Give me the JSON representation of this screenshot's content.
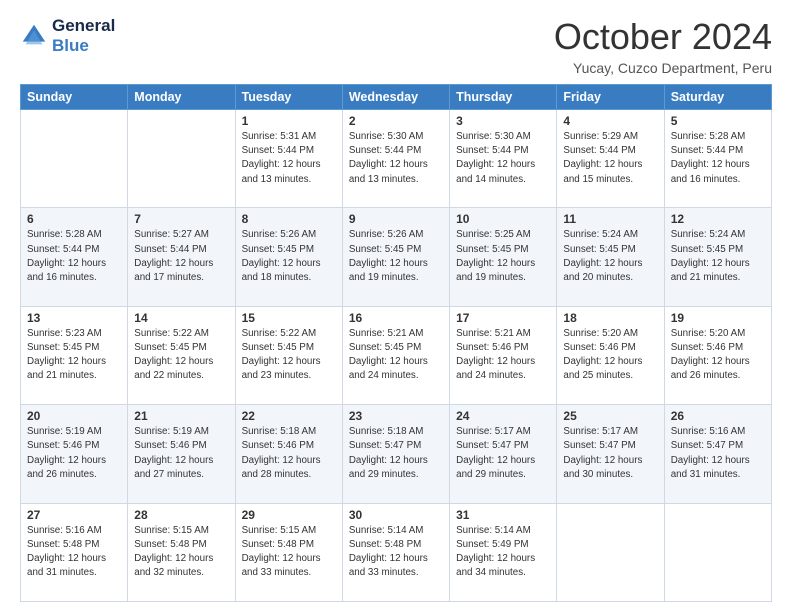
{
  "logo": {
    "line1": "General",
    "line2": "Blue"
  },
  "title": "October 2024",
  "subtitle": "Yucay, Cuzco Department, Peru",
  "days_header": [
    "Sunday",
    "Monday",
    "Tuesday",
    "Wednesday",
    "Thursday",
    "Friday",
    "Saturday"
  ],
  "weeks": [
    [
      {
        "day": "",
        "sunrise": "",
        "sunset": "",
        "daylight": ""
      },
      {
        "day": "",
        "sunrise": "",
        "sunset": "",
        "daylight": ""
      },
      {
        "day": "1",
        "sunrise": "Sunrise: 5:31 AM",
        "sunset": "Sunset: 5:44 PM",
        "daylight": "Daylight: 12 hours and 13 minutes."
      },
      {
        "day": "2",
        "sunrise": "Sunrise: 5:30 AM",
        "sunset": "Sunset: 5:44 PM",
        "daylight": "Daylight: 12 hours and 13 minutes."
      },
      {
        "day": "3",
        "sunrise": "Sunrise: 5:30 AM",
        "sunset": "Sunset: 5:44 PM",
        "daylight": "Daylight: 12 hours and 14 minutes."
      },
      {
        "day": "4",
        "sunrise": "Sunrise: 5:29 AM",
        "sunset": "Sunset: 5:44 PM",
        "daylight": "Daylight: 12 hours and 15 minutes."
      },
      {
        "day": "5",
        "sunrise": "Sunrise: 5:28 AM",
        "sunset": "Sunset: 5:44 PM",
        "daylight": "Daylight: 12 hours and 16 minutes."
      }
    ],
    [
      {
        "day": "6",
        "sunrise": "Sunrise: 5:28 AM",
        "sunset": "Sunset: 5:44 PM",
        "daylight": "Daylight: 12 hours and 16 minutes."
      },
      {
        "day": "7",
        "sunrise": "Sunrise: 5:27 AM",
        "sunset": "Sunset: 5:44 PM",
        "daylight": "Daylight: 12 hours and 17 minutes."
      },
      {
        "day": "8",
        "sunrise": "Sunrise: 5:26 AM",
        "sunset": "Sunset: 5:45 PM",
        "daylight": "Daylight: 12 hours and 18 minutes."
      },
      {
        "day": "9",
        "sunrise": "Sunrise: 5:26 AM",
        "sunset": "Sunset: 5:45 PM",
        "daylight": "Daylight: 12 hours and 19 minutes."
      },
      {
        "day": "10",
        "sunrise": "Sunrise: 5:25 AM",
        "sunset": "Sunset: 5:45 PM",
        "daylight": "Daylight: 12 hours and 19 minutes."
      },
      {
        "day": "11",
        "sunrise": "Sunrise: 5:24 AM",
        "sunset": "Sunset: 5:45 PM",
        "daylight": "Daylight: 12 hours and 20 minutes."
      },
      {
        "day": "12",
        "sunrise": "Sunrise: 5:24 AM",
        "sunset": "Sunset: 5:45 PM",
        "daylight": "Daylight: 12 hours and 21 minutes."
      }
    ],
    [
      {
        "day": "13",
        "sunrise": "Sunrise: 5:23 AM",
        "sunset": "Sunset: 5:45 PM",
        "daylight": "Daylight: 12 hours and 21 minutes."
      },
      {
        "day": "14",
        "sunrise": "Sunrise: 5:22 AM",
        "sunset": "Sunset: 5:45 PM",
        "daylight": "Daylight: 12 hours and 22 minutes."
      },
      {
        "day": "15",
        "sunrise": "Sunrise: 5:22 AM",
        "sunset": "Sunset: 5:45 PM",
        "daylight": "Daylight: 12 hours and 23 minutes."
      },
      {
        "day": "16",
        "sunrise": "Sunrise: 5:21 AM",
        "sunset": "Sunset: 5:45 PM",
        "daylight": "Daylight: 12 hours and 24 minutes."
      },
      {
        "day": "17",
        "sunrise": "Sunrise: 5:21 AM",
        "sunset": "Sunset: 5:46 PM",
        "daylight": "Daylight: 12 hours and 24 minutes."
      },
      {
        "day": "18",
        "sunrise": "Sunrise: 5:20 AM",
        "sunset": "Sunset: 5:46 PM",
        "daylight": "Daylight: 12 hours and 25 minutes."
      },
      {
        "day": "19",
        "sunrise": "Sunrise: 5:20 AM",
        "sunset": "Sunset: 5:46 PM",
        "daylight": "Daylight: 12 hours and 26 minutes."
      }
    ],
    [
      {
        "day": "20",
        "sunrise": "Sunrise: 5:19 AM",
        "sunset": "Sunset: 5:46 PM",
        "daylight": "Daylight: 12 hours and 26 minutes."
      },
      {
        "day": "21",
        "sunrise": "Sunrise: 5:19 AM",
        "sunset": "Sunset: 5:46 PM",
        "daylight": "Daylight: 12 hours and 27 minutes."
      },
      {
        "day": "22",
        "sunrise": "Sunrise: 5:18 AM",
        "sunset": "Sunset: 5:46 PM",
        "daylight": "Daylight: 12 hours and 28 minutes."
      },
      {
        "day": "23",
        "sunrise": "Sunrise: 5:18 AM",
        "sunset": "Sunset: 5:47 PM",
        "daylight": "Daylight: 12 hours and 29 minutes."
      },
      {
        "day": "24",
        "sunrise": "Sunrise: 5:17 AM",
        "sunset": "Sunset: 5:47 PM",
        "daylight": "Daylight: 12 hours and 29 minutes."
      },
      {
        "day": "25",
        "sunrise": "Sunrise: 5:17 AM",
        "sunset": "Sunset: 5:47 PM",
        "daylight": "Daylight: 12 hours and 30 minutes."
      },
      {
        "day": "26",
        "sunrise": "Sunrise: 5:16 AM",
        "sunset": "Sunset: 5:47 PM",
        "daylight": "Daylight: 12 hours and 31 minutes."
      }
    ],
    [
      {
        "day": "27",
        "sunrise": "Sunrise: 5:16 AM",
        "sunset": "Sunset: 5:48 PM",
        "daylight": "Daylight: 12 hours and 31 minutes."
      },
      {
        "day": "28",
        "sunrise": "Sunrise: 5:15 AM",
        "sunset": "Sunset: 5:48 PM",
        "daylight": "Daylight: 12 hours and 32 minutes."
      },
      {
        "day": "29",
        "sunrise": "Sunrise: 5:15 AM",
        "sunset": "Sunset: 5:48 PM",
        "daylight": "Daylight: 12 hours and 33 minutes."
      },
      {
        "day": "30",
        "sunrise": "Sunrise: 5:14 AM",
        "sunset": "Sunset: 5:48 PM",
        "daylight": "Daylight: 12 hours and 33 minutes."
      },
      {
        "day": "31",
        "sunrise": "Sunrise: 5:14 AM",
        "sunset": "Sunset: 5:49 PM",
        "daylight": "Daylight: 12 hours and 34 minutes."
      },
      {
        "day": "",
        "sunrise": "",
        "sunset": "",
        "daylight": ""
      },
      {
        "day": "",
        "sunrise": "",
        "sunset": "",
        "daylight": ""
      }
    ]
  ]
}
